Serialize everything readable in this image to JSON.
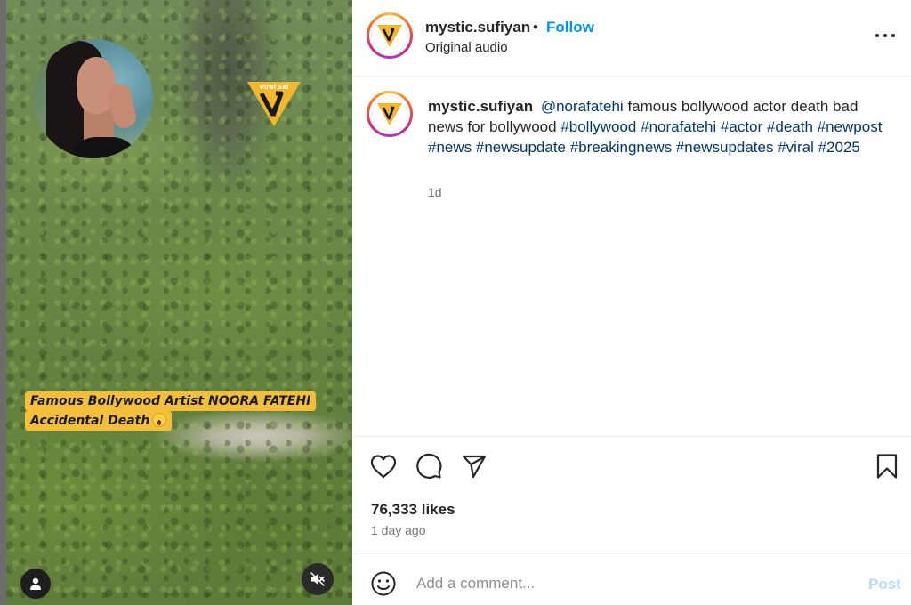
{
  "video": {
    "overlay_caption_line1": "Famous Bollywood Artist NOORA FATEHI",
    "overlay_caption_line2": "Accidental Death",
    "watermark_text": "Viral Ski",
    "caption_color": "#f3be3a"
  },
  "header": {
    "username": "mystic.sufiyan",
    "separator": "•",
    "follow_label": "Follow",
    "audio_label": "Original audio",
    "follow_color": "#0095f6"
  },
  "caption": {
    "username": "mystic.sufiyan",
    "mention": "@norafatehi",
    "text": "famous bollywood actor death bad news for bollywood",
    "hashtags": [
      "#bollywood",
      "#norafatehi",
      "#actor",
      "#death",
      "#newpost",
      "#news",
      "#newsupdate",
      "#breakingnews",
      "#newsupdates",
      "#viral",
      "#2025"
    ],
    "time": "1d",
    "link_color": "#00376b"
  },
  "actions": {
    "likes": "76,333 likes",
    "age": "1 day ago",
    "icons": [
      "heart-icon",
      "comment-icon",
      "share-icon",
      "bookmark-icon"
    ]
  },
  "add_comment": {
    "placeholder": "Add a comment...",
    "post_label": "Post"
  }
}
